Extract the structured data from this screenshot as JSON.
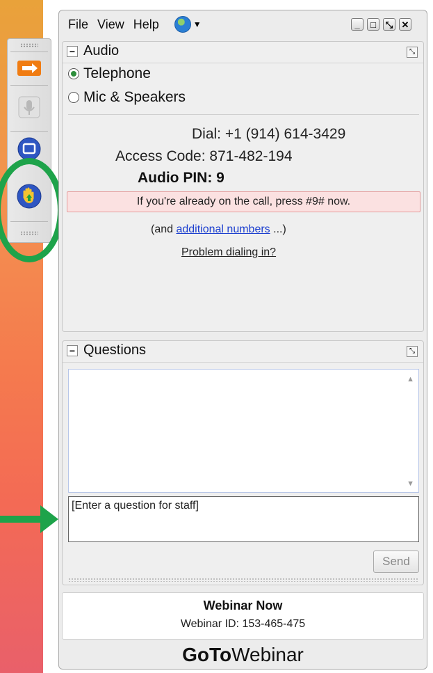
{
  "menu": {
    "file": "File",
    "view": "View",
    "help": "Help"
  },
  "audio": {
    "title": "Audio",
    "options": [
      "Telephone",
      "Mic & Speakers"
    ],
    "selected": "Telephone",
    "dial_label": "Dial:",
    "dial_number": "+1 (914) 614-3429",
    "access_label": "Access Code:",
    "access_code": "871-482-194",
    "pin_label": "Audio PIN:",
    "pin": "9",
    "alert": "If you're already on the call, press #9# now.",
    "additional_prefix": "(and ",
    "additional_link": "additional numbers",
    "additional_suffix": " ...)",
    "problem_link": "Problem dialing in?"
  },
  "questions": {
    "title": "Questions",
    "input_value": "[Enter a question for staff]",
    "send_label": "Send"
  },
  "webinar": {
    "name": "Webinar Now",
    "id_text": "Webinar ID: 153-465-475"
  },
  "logo": {
    "goto": "GoTo",
    "webinar": "Webinar"
  },
  "colors": {
    "annotation_green": "#1ea34a",
    "link_blue": "#1c3fcf",
    "alert_bg": "#fbe1e1"
  }
}
